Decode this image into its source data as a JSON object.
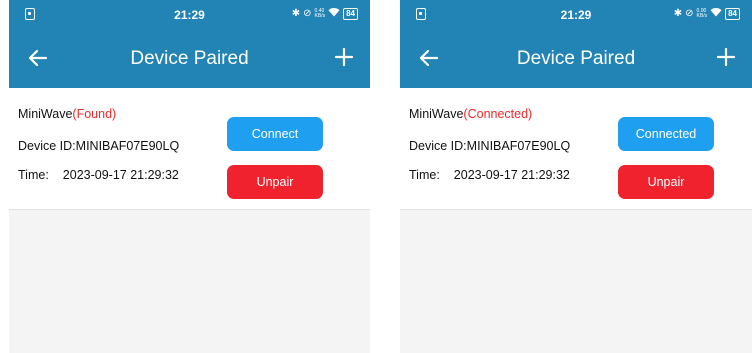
{
  "screens": [
    {
      "status_bar": {
        "time": "21:29",
        "signal_text": "0.40\nKB/s",
        "battery": "84"
      },
      "header": {
        "title": "Device Paired"
      },
      "device": {
        "name": "MiniWave",
        "status": "(Found)",
        "id_label": "Device ID:",
        "id_value": "MINIBAF07E90LQ",
        "time_label": "Time:",
        "time_value": "2023-09-17 21:29:32",
        "connect_label": "Connect",
        "unpair_label": "Unpair"
      }
    },
    {
      "status_bar": {
        "time": "21:29",
        "signal_text": "0.00\nKB/s",
        "battery": "84"
      },
      "header": {
        "title": "Device Paired"
      },
      "device": {
        "name": "MiniWave",
        "status": "(Connected)",
        "id_label": "Device ID:",
        "id_value": "MINIBAF07E90LQ",
        "time_label": "Time:",
        "time_value": "2023-09-17 21:29:32",
        "connect_label": "Connected",
        "unpair_label": "Unpair"
      }
    }
  ],
  "colors": {
    "app_bar": "#2283b5",
    "connect_button": "#1e9ff0",
    "unpair_button": "#f0222d",
    "status_text": "#f02a2a",
    "background": "#f4f4f4"
  },
  "icons": {
    "back": "arrow-left-icon",
    "add": "plus-icon",
    "bluetooth": "bluetooth-icon",
    "mute": "mute-icon",
    "wifi": "wifi-icon",
    "battery": "battery-icon",
    "app_notification": "app-notification-icon"
  }
}
